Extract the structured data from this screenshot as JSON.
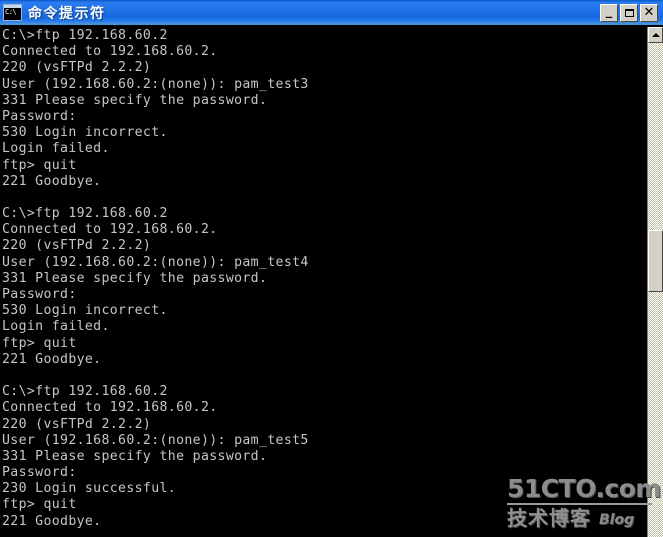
{
  "window": {
    "title": "命令提示符",
    "icon": "cmd-console-icon",
    "icon_prompt": "C:\\",
    "controls": {
      "minimize_label": "_",
      "maximize_label": "",
      "close_label": "✕"
    }
  },
  "console": {
    "lines": [
      "C:\\>ftp 192.168.60.2",
      "Connected to 192.168.60.2.",
      "220 (vsFTPd 2.2.2)",
      "User (192.168.60.2:(none)): pam_test3",
      "331 Please specify the password.",
      "Password:",
      "530 Login incorrect.",
      "Login failed.",
      "ftp> quit",
      "221 Goodbye.",
      "",
      "C:\\>ftp 192.168.60.2",
      "Connected to 192.168.60.2.",
      "220 (vsFTPd 2.2.2)",
      "User (192.168.60.2:(none)): pam_test4",
      "331 Please specify the password.",
      "Password:",
      "530 Login incorrect.",
      "Login failed.",
      "ftp> quit",
      "221 Goodbye.",
      "",
      "C:\\>ftp 192.168.60.2",
      "Connected to 192.168.60.2.",
      "220 (vsFTPd 2.2.2)",
      "User (192.168.60.2:(none)): pam_test5",
      "331 Please specify the password.",
      "Password:",
      "230 Login successful.",
      "ftp> quit",
      "221 Goodbye."
    ],
    "text_color": "#c6c6c6",
    "background_color": "#000000"
  },
  "scrollbar": {
    "up_arrow": "▲"
  },
  "watermark": {
    "site": "51CTO.com",
    "tagline": "技术博客",
    "blog": "Blog"
  }
}
